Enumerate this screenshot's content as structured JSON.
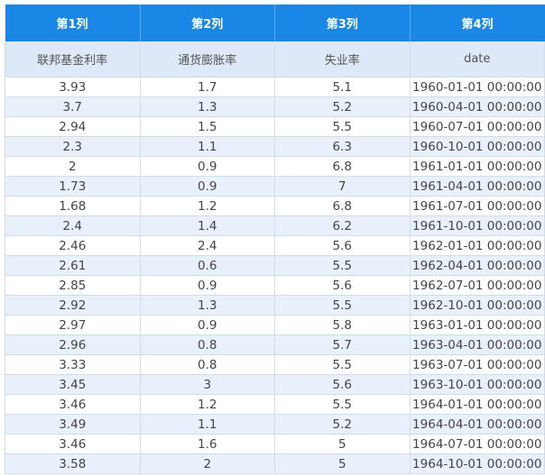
{
  "headers": [
    "第1列",
    "第2列",
    "第3列",
    "第4列"
  ],
  "subheaders": [
    "联邦基金利率",
    "通货膨胀率",
    "失业率",
    "date"
  ],
  "rows": [
    [
      "3.93",
      "1.7",
      "5.1",
      "1960-01-01 00:00:00"
    ],
    [
      "3.7",
      "1.3",
      "5.2",
      "1960-04-01 00:00:00"
    ],
    [
      "2.94",
      "1.5",
      "5.5",
      "1960-07-01 00:00:00"
    ],
    [
      "2.3",
      "1.1",
      "6.3",
      "1960-10-01 00:00:00"
    ],
    [
      "2",
      "0.9",
      "6.8",
      "1961-01-01 00:00:00"
    ],
    [
      "1.73",
      "0.9",
      "7",
      "1961-04-01 00:00:00"
    ],
    [
      "1.68",
      "1.2",
      "6.8",
      "1961-07-01 00:00:00"
    ],
    [
      "2.4",
      "1.4",
      "6.2",
      "1961-10-01 00:00:00"
    ],
    [
      "2.46",
      "2.4",
      "5.6",
      "1962-01-01 00:00:00"
    ],
    [
      "2.61",
      "0.6",
      "5.5",
      "1962-04-01 00:00:00"
    ],
    [
      "2.85",
      "0.9",
      "5.6",
      "1962-07-01 00:00:00"
    ],
    [
      "2.92",
      "1.3",
      "5.5",
      "1962-10-01 00:00:00"
    ],
    [
      "2.97",
      "0.9",
      "5.8",
      "1963-01-01 00:00:00"
    ],
    [
      "2.96",
      "0.8",
      "5.7",
      "1963-04-01 00:00:00"
    ],
    [
      "3.33",
      "0.8",
      "5.5",
      "1963-07-01 00:00:00"
    ],
    [
      "3.45",
      "3",
      "5.6",
      "1963-10-01 00:00:00"
    ],
    [
      "3.46",
      "1.2",
      "5.5",
      "1964-01-01 00:00:00"
    ],
    [
      "3.49",
      "1.1",
      "5.2",
      "1964-04-01 00:00:00"
    ],
    [
      "3.46",
      "1.6",
      "5",
      "1964-07-01 00:00:00"
    ],
    [
      "3.58",
      "2",
      "5",
      "1964-10-01 00:00:00"
    ]
  ]
}
